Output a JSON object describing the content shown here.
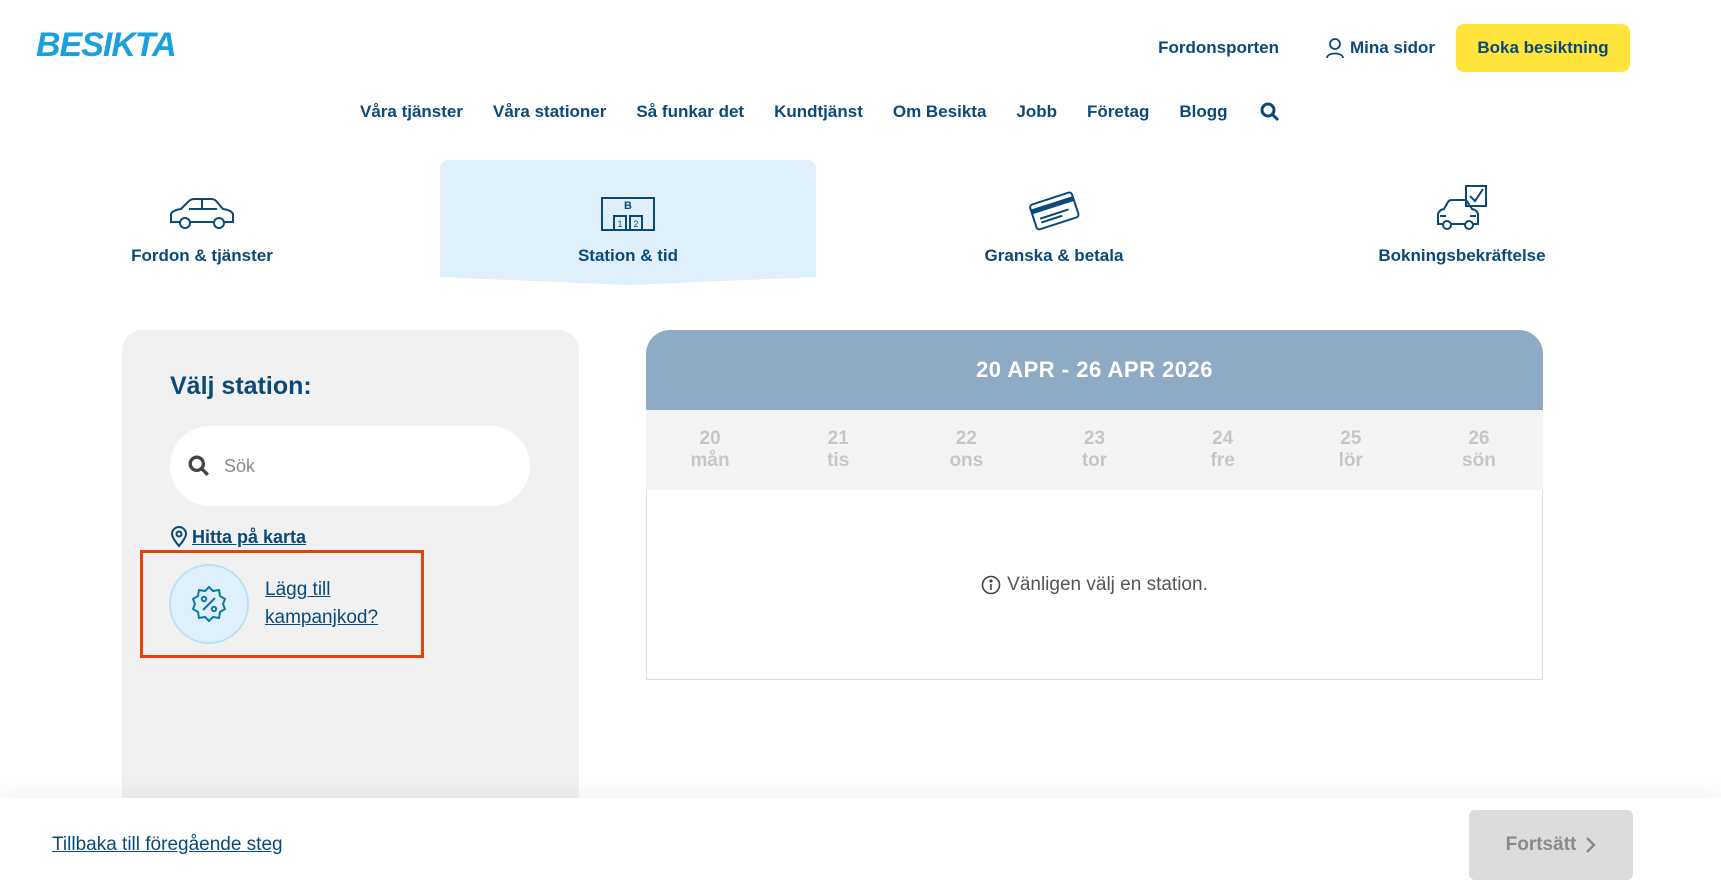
{
  "header": {
    "logo": "BESIKTA",
    "links": [
      {
        "label": "Fordonsporten"
      },
      {
        "label": "Mina sidor"
      }
    ],
    "cta": "Boka besiktning"
  },
  "nav": [
    "Våra tjänster",
    "Våra stationer",
    "Så funkar det",
    "Kundtjänst",
    "Om Besikta",
    "Jobb",
    "Företag",
    "Blogg"
  ],
  "steps": [
    {
      "label": "Fordon & tjänster",
      "icon": "car-icon"
    },
    {
      "label": "Station & tid",
      "icon": "station-icon",
      "active": true
    },
    {
      "label": "Granska & betala",
      "icon": "card-icon"
    },
    {
      "label": "Bokningsbekräftelse",
      "icon": "car-check-icon"
    }
  ],
  "station": {
    "title": "Välj station:",
    "search_placeholder": "Sök",
    "map_link": "Hitta på karta",
    "promo_link": "Lägg till kampanjkod?"
  },
  "calendar": {
    "range": "20 APR - 26 APR 2026",
    "days": [
      {
        "num": "20",
        "day": "mån"
      },
      {
        "num": "21",
        "day": "tis"
      },
      {
        "num": "22",
        "day": "ons"
      },
      {
        "num": "23",
        "day": "tor"
      },
      {
        "num": "24",
        "day": "fre"
      },
      {
        "num": "25",
        "day": "lör"
      },
      {
        "num": "26",
        "day": "sön"
      }
    ],
    "message": "Vänligen välj en station."
  },
  "footer": {
    "back": "Tillbaka till föregående steg",
    "continue": "Fortsätt"
  },
  "colors": {
    "brand": "#0a4a7a",
    "logo": "#1aa0dc",
    "cta": "#ffe53b",
    "active_step": "#dff0fb",
    "calendar_header": "#8eabc6",
    "highlight": "#e8400c"
  }
}
